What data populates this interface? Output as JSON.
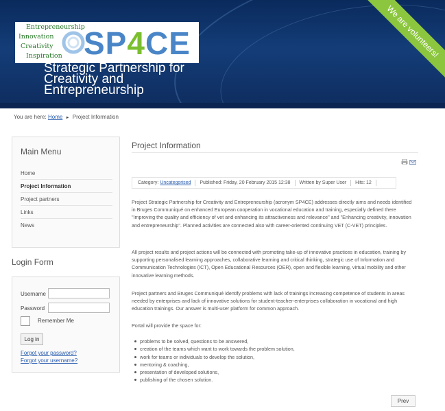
{
  "header": {
    "logo_words": [
      "Entrepreneurship",
      "Innovation",
      "Creativity",
      "Inspiration"
    ],
    "logo_text": {
      "sp": "SP",
      "four": "4",
      "ce": "CE"
    },
    "site_title": "Strategic Partnership for\nCreativity and\nEntrepreneurship",
    "ribbon": "We are volunteers!"
  },
  "breadcrumb": {
    "prefix": "You are here:",
    "home": "Home",
    "current": "Project Information"
  },
  "main_menu": {
    "title": "Main Menu",
    "items": [
      {
        "label": "Home",
        "active": false
      },
      {
        "label": "Project Information",
        "active": true
      },
      {
        "label": "Project partners",
        "active": false
      },
      {
        "label": "Links",
        "active": false
      },
      {
        "label": "News",
        "active": false
      }
    ]
  },
  "login": {
    "title": "Login Form",
    "username_label": "Username",
    "password_label": "Password",
    "remember_label": "Remember Me",
    "login_button": "Log in",
    "forgot_password": "Forgot your password?",
    "forgot_username": "Forgot your username?"
  },
  "article": {
    "title": "Project Information",
    "category_label": "Category:",
    "category": "Uncategorised",
    "published": "Published: Friday, 20 February 2015 12:38",
    "author": "Written by Super User",
    "hits": "Hits: 12",
    "paragraphs": [
      "Project Strategic Partnership for Creativity and Entrepreneurship (acronym SP4CE) addresses directly aims and needs identified in Bruges Communiqué on enhanced European cooperation in vocational education and training, especially defined there \"Improving the quality and efficiency of vet and enhancing its attractiveness and relevance\" and \"Enhancing creativity, innovation and entrepreneurship\". Planned activities are connected also with career-oriented continuing VET (C-VET) principles.",
      "All project results and project actions will be connected with promoting take-up of innovative practices in education, training by supporting personalised learning approaches, collaborative learning and critical thinking, strategic use of Information and Communication Technologies (ICT), Open Educational Resources (OER), open and flexible learning, virtual mobility and other innovative learning methods.",
      "Project partners and Bruges Communiqué identify problems with lack of trainings increasing competence of students in areas needed by enterprises and lack of innovative solutions for student-teacher-enterprises collaboration in vocational and high education trainings. Our answer is multi-user platform for common approach.",
      "Portal will provide the space for:"
    ],
    "bullets": [
      "problems to be solved, questions to be answered,",
      "creation of the teams which want to work towards the problem solution,",
      "work for teams or individuals to develop the solution,",
      "mentoring & coaching,",
      "presentation of developed solutions,",
      "publishing of the chosen solution."
    ],
    "prev_button": "Prev"
  },
  "icons": {
    "print": "print-icon",
    "email": "email-icon"
  },
  "colors": {
    "header_bg": "#143d78",
    "ribbon": "#8cc63f",
    "link": "#2a5db0",
    "logo_blue": "#4a86c7",
    "logo_green": "#7bbf2e"
  }
}
